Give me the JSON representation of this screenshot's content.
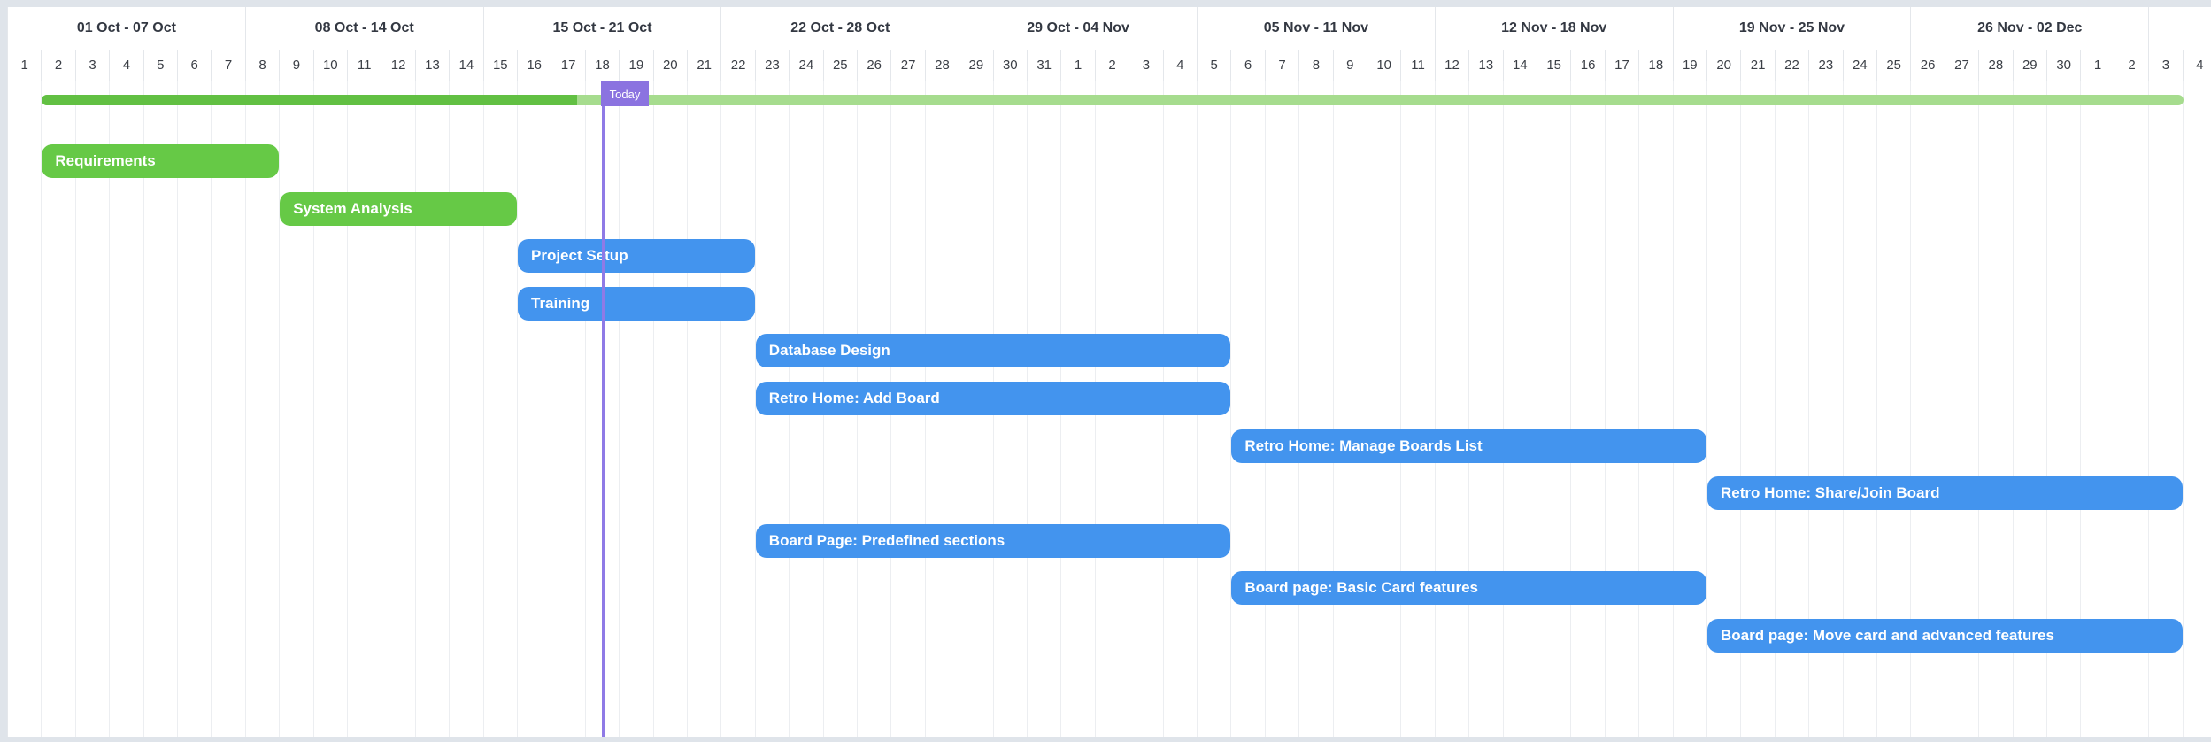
{
  "timeline": {
    "weeks": [
      "01 Oct - 07 Oct",
      "08 Oct - 14 Oct",
      "15 Oct - 21 Oct",
      "22 Oct - 28 Oct",
      "29 Oct - 04 Nov",
      "05 Nov - 11 Nov",
      "12 Nov - 18 Nov",
      "19 Nov - 25 Nov",
      "26 Nov - 02 Dec"
    ],
    "days": [
      "1",
      "2",
      "3",
      "4",
      "5",
      "6",
      "7",
      "8",
      "9",
      "10",
      "11",
      "12",
      "13",
      "14",
      "15",
      "16",
      "17",
      "18",
      "19",
      "20",
      "21",
      "22",
      "23",
      "24",
      "25",
      "26",
      "27",
      "28",
      "29",
      "30",
      "31",
      "1",
      "2",
      "3",
      "4",
      "5",
      "6",
      "7",
      "8",
      "9",
      "10",
      "11",
      "12",
      "13",
      "14",
      "15",
      "16",
      "17",
      "18",
      "19",
      "20",
      "21",
      "22",
      "23",
      "24",
      "25",
      "26",
      "27",
      "28",
      "29",
      "30",
      "1",
      "2",
      "3",
      "4"
    ],
    "today_label": "Today",
    "today_day_index": 17
  },
  "summary": {
    "start_day_index": 1,
    "end_day_index": 64,
    "progress_fraction": 0.25
  },
  "tasks": [
    {
      "label": "Requirements",
      "start_day_index": 1,
      "end_day_index": 8,
      "status": "done",
      "color": "#66c946"
    },
    {
      "label": "System Analysis",
      "start_day_index": 8,
      "end_day_index": 15,
      "status": "done",
      "color": "#66c946"
    },
    {
      "label": "Project Setup",
      "start_day_index": 15,
      "end_day_index": 22,
      "status": "todo",
      "color": "#4394ee"
    },
    {
      "label": "Training",
      "start_day_index": 15,
      "end_day_index": 22,
      "status": "todo",
      "color": "#4394ee"
    },
    {
      "label": "Database Design",
      "start_day_index": 22,
      "end_day_index": 36,
      "status": "todo",
      "color": "#4394ee"
    },
    {
      "label": "Retro Home: Add Board",
      "start_day_index": 22,
      "end_day_index": 36,
      "status": "todo",
      "color": "#4394ee"
    },
    {
      "label": "Retro Home: Manage Boards List",
      "start_day_index": 36,
      "end_day_index": 50,
      "status": "todo",
      "color": "#4394ee"
    },
    {
      "label": "Retro Home: Share/Join Board",
      "start_day_index": 50,
      "end_day_index": 64,
      "status": "todo",
      "color": "#4394ee"
    },
    {
      "label": "Board Page: Predefined sections",
      "start_day_index": 22,
      "end_day_index": 36,
      "status": "todo",
      "color": "#4394ee"
    },
    {
      "label": "Board page: Basic Card features",
      "start_day_index": 36,
      "end_day_index": 50,
      "status": "todo",
      "color": "#4394ee"
    },
    {
      "label": "Board page: Move card and advanced features",
      "start_day_index": 50,
      "end_day_index": 64,
      "status": "todo",
      "color": "#4394ee"
    }
  ]
}
